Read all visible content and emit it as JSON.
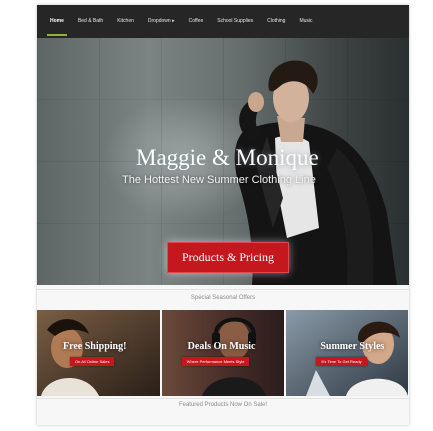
{
  "nav": {
    "items": [
      {
        "label": "Home",
        "active": true
      },
      {
        "label": "Bed & Bath",
        "active": false
      },
      {
        "label": "Kitchen",
        "active": false
      },
      {
        "label": "Dropdown ▸",
        "active": false
      },
      {
        "label": "Coffee",
        "active": false
      },
      {
        "label": "School Supplies",
        "active": false
      },
      {
        "label": "Clothing",
        "active": false
      },
      {
        "label": "Music",
        "active": false
      }
    ],
    "active_color": "#8fb33a"
  },
  "hero": {
    "title": "Maggie & Monique",
    "subtitle": "The Hottest New Summer Clothing Line",
    "button_label": "Products & Pricing",
    "slides": 2,
    "active_slide": 2
  },
  "sections": {
    "offers_title": "Special Seasonal Offers",
    "featured_title": "Featured Products Now On Sale!"
  },
  "promos": [
    {
      "title": "Free Shipping!",
      "tag": "On All Online Sales"
    },
    {
      "title": "Deals On Music",
      "tag": "Where Performance Meets Style"
    },
    {
      "title": "Summer Styles",
      "tag": "It's Time To Get Ready"
    }
  ],
  "colors": {
    "accent_red": "#c5171e",
    "nav_bg": "#262626"
  }
}
